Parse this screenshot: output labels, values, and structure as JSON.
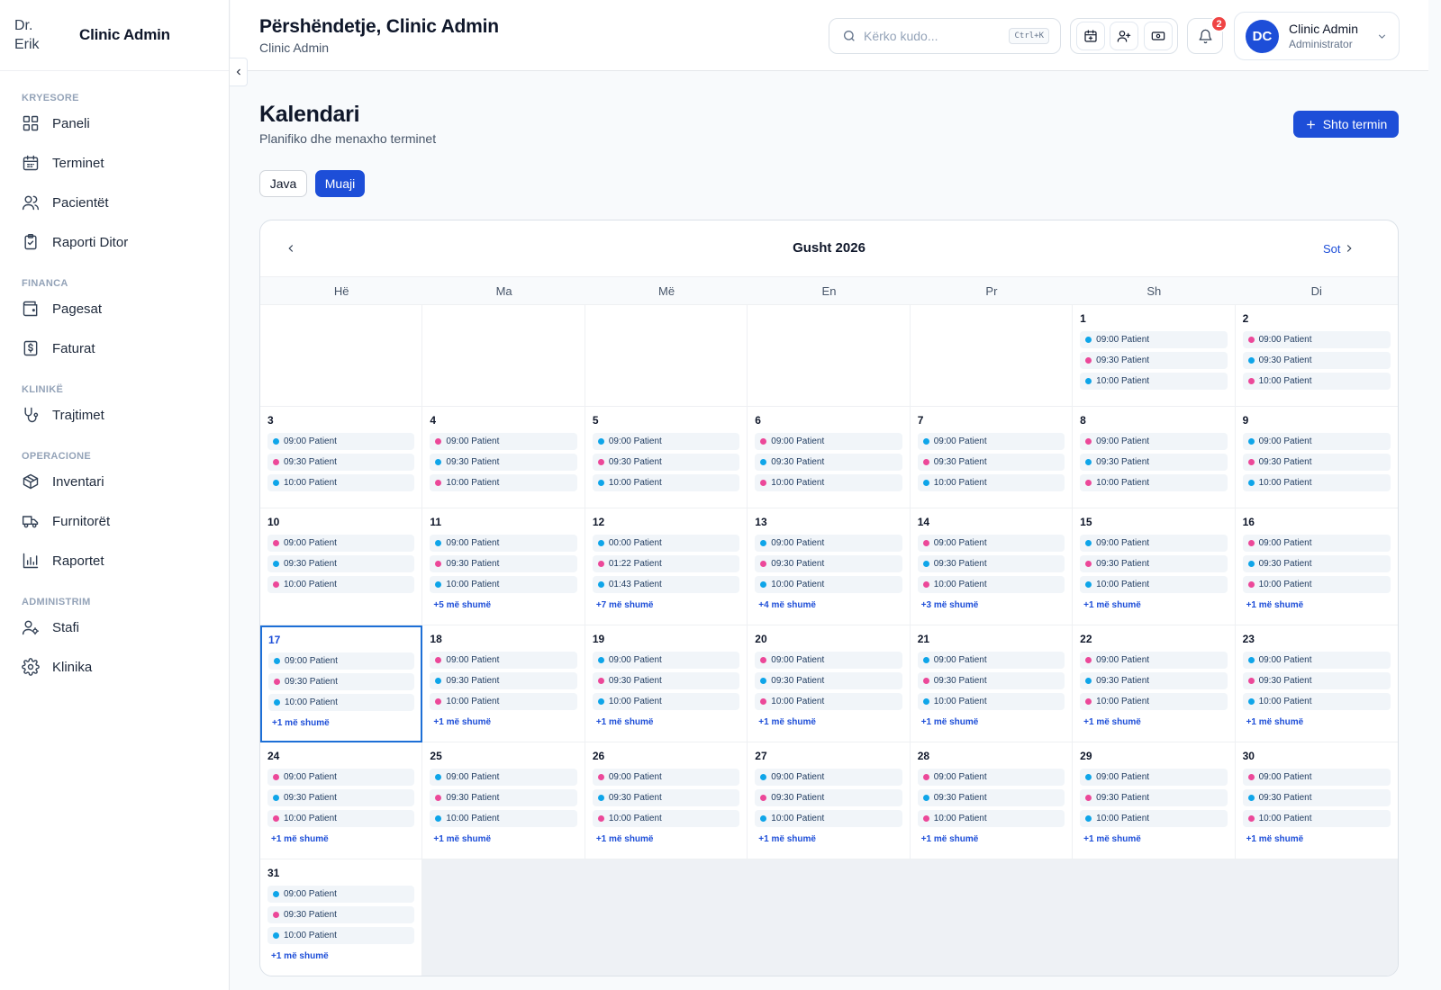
{
  "brand": {
    "logo_alt": "Dr. Erik",
    "name": "Clinic Admin"
  },
  "nav": [
    {
      "section": "KRYESORE",
      "items": [
        {
          "name": "paneli",
          "icon": "dashboard-icon",
          "label": "Paneli"
        },
        {
          "name": "terminet",
          "icon": "calendar-icon",
          "label": "Terminet"
        },
        {
          "name": "pacientet",
          "icon": "users-icon",
          "label": "Pacientët"
        },
        {
          "name": "raporti-ditor",
          "icon": "clipboard-icon",
          "label": "Raporti Ditor"
        }
      ]
    },
    {
      "section": "FINANCA",
      "items": [
        {
          "name": "pagesat",
          "icon": "wallet-icon",
          "label": "Pagesat"
        },
        {
          "name": "faturat",
          "icon": "invoice-icon",
          "label": "Faturat"
        }
      ]
    },
    {
      "section": "KLINIKË",
      "items": [
        {
          "name": "trajtimet",
          "icon": "stethoscope-icon",
          "label": "Trajtimet"
        }
      ]
    },
    {
      "section": "OPERACIONE",
      "items": [
        {
          "name": "inventari",
          "icon": "package-icon",
          "label": "Inventari"
        },
        {
          "name": "furnitoret",
          "icon": "truck-icon",
          "label": "Furnitorët"
        },
        {
          "name": "raportet",
          "icon": "bar-chart-icon",
          "label": "Raportet"
        }
      ]
    },
    {
      "section": "ADMINISTRIM",
      "items": [
        {
          "name": "stafi",
          "icon": "user-cog-icon",
          "label": "Stafi"
        },
        {
          "name": "klinika",
          "icon": "gear-icon",
          "label": "Klinika"
        }
      ]
    }
  ],
  "header": {
    "greeting": "Përshëndetje, Clinic Admin",
    "subtitle": "Clinic Admin",
    "search_placeholder": "Kërko kudo...",
    "search_shortcut": "Ctrl+K",
    "notifications_count": "2",
    "user": {
      "initials": "DC",
      "name": "Clinic Admin",
      "role": "Administrator"
    }
  },
  "page": {
    "title": "Kalendari",
    "subtitle": "Planifiko dhe menaxho terminet",
    "add_button": "Shto termin",
    "views": {
      "week": "Java",
      "month": "Muaji"
    }
  },
  "calendar": {
    "month_title": "Gusht 2026",
    "today_label": "Sot",
    "weekdays": [
      "Hë",
      "Ma",
      "Më",
      "En",
      "Pr",
      "Sh",
      "Di"
    ],
    "leading_blanks": 5,
    "today": 17,
    "colors": {
      "blue": "#0ea5e9",
      "pink": "#ec4899"
    },
    "days": [
      {
        "day": "1",
        "events": [
          [
            "09:00 Patient",
            "blue"
          ],
          [
            "09:30 Patient",
            "pink"
          ],
          [
            "10:00 Patient",
            "blue"
          ]
        ],
        "more": ""
      },
      {
        "day": "2",
        "events": [
          [
            "09:00 Patient",
            "pink"
          ],
          [
            "09:30 Patient",
            "blue"
          ],
          [
            "10:00 Patient",
            "pink"
          ]
        ],
        "more": ""
      },
      {
        "day": "3",
        "events": [
          [
            "09:00 Patient",
            "blue"
          ],
          [
            "09:30 Patient",
            "pink"
          ],
          [
            "10:00 Patient",
            "blue"
          ]
        ],
        "more": ""
      },
      {
        "day": "4",
        "events": [
          [
            "09:00 Patient",
            "pink"
          ],
          [
            "09:30 Patient",
            "blue"
          ],
          [
            "10:00 Patient",
            "pink"
          ]
        ],
        "more": ""
      },
      {
        "day": "5",
        "events": [
          [
            "09:00 Patient",
            "blue"
          ],
          [
            "09:30 Patient",
            "pink"
          ],
          [
            "10:00 Patient",
            "blue"
          ]
        ],
        "more": ""
      },
      {
        "day": "6",
        "events": [
          [
            "09:00 Patient",
            "pink"
          ],
          [
            "09:30 Patient",
            "blue"
          ],
          [
            "10:00 Patient",
            "pink"
          ]
        ],
        "more": ""
      },
      {
        "day": "7",
        "events": [
          [
            "09:00 Patient",
            "blue"
          ],
          [
            "09:30 Patient",
            "pink"
          ],
          [
            "10:00 Patient",
            "blue"
          ]
        ],
        "more": ""
      },
      {
        "day": "8",
        "events": [
          [
            "09:00 Patient",
            "pink"
          ],
          [
            "09:30 Patient",
            "blue"
          ],
          [
            "10:00 Patient",
            "pink"
          ]
        ],
        "more": ""
      },
      {
        "day": "9",
        "events": [
          [
            "09:00 Patient",
            "blue"
          ],
          [
            "09:30 Patient",
            "pink"
          ],
          [
            "10:00 Patient",
            "blue"
          ]
        ],
        "more": ""
      },
      {
        "day": "10",
        "events": [
          [
            "09:00 Patient",
            "pink"
          ],
          [
            "09:30 Patient",
            "blue"
          ],
          [
            "10:00 Patient",
            "pink"
          ]
        ],
        "more": ""
      },
      {
        "day": "11",
        "events": [
          [
            "09:00 Patient",
            "blue"
          ],
          [
            "09:30 Patient",
            "pink"
          ],
          [
            "10:00 Patient",
            "blue"
          ]
        ],
        "more": "+5 më shumë"
      },
      {
        "day": "12",
        "events": [
          [
            "00:00 Patient",
            "blue"
          ],
          [
            "01:22 Patient",
            "pink"
          ],
          [
            "01:43 Patient",
            "blue"
          ]
        ],
        "more": "+7 më shumë"
      },
      {
        "day": "13",
        "events": [
          [
            "09:00 Patient",
            "blue"
          ],
          [
            "09:30 Patient",
            "pink"
          ],
          [
            "10:00 Patient",
            "blue"
          ]
        ],
        "more": "+4 më shumë"
      },
      {
        "day": "14",
        "events": [
          [
            "09:00 Patient",
            "pink"
          ],
          [
            "09:30 Patient",
            "blue"
          ],
          [
            "10:00 Patient",
            "pink"
          ]
        ],
        "more": "+3 më shumë"
      },
      {
        "day": "15",
        "events": [
          [
            "09:00 Patient",
            "blue"
          ],
          [
            "09:30 Patient",
            "pink"
          ],
          [
            "10:00 Patient",
            "blue"
          ]
        ],
        "more": "+1 më shumë"
      },
      {
        "day": "16",
        "events": [
          [
            "09:00 Patient",
            "pink"
          ],
          [
            "09:30 Patient",
            "blue"
          ],
          [
            "10:00 Patient",
            "pink"
          ]
        ],
        "more": "+1 më shumë"
      },
      {
        "day": "17",
        "events": [
          [
            "09:00 Patient",
            "blue"
          ],
          [
            "09:30 Patient",
            "pink"
          ],
          [
            "10:00 Patient",
            "blue"
          ]
        ],
        "more": "+1 më shumë"
      },
      {
        "day": "18",
        "events": [
          [
            "09:00 Patient",
            "pink"
          ],
          [
            "09:30 Patient",
            "blue"
          ],
          [
            "10:00 Patient",
            "pink"
          ]
        ],
        "more": "+1 më shumë"
      },
      {
        "day": "19",
        "events": [
          [
            "09:00 Patient",
            "blue"
          ],
          [
            "09:30 Patient",
            "pink"
          ],
          [
            "10:00 Patient",
            "blue"
          ]
        ],
        "more": "+1 më shumë"
      },
      {
        "day": "20",
        "events": [
          [
            "09:00 Patient",
            "pink"
          ],
          [
            "09:30 Patient",
            "blue"
          ],
          [
            "10:00 Patient",
            "pink"
          ]
        ],
        "more": "+1 më shumë"
      },
      {
        "day": "21",
        "events": [
          [
            "09:00 Patient",
            "blue"
          ],
          [
            "09:30 Patient",
            "pink"
          ],
          [
            "10:00 Patient",
            "blue"
          ]
        ],
        "more": "+1 më shumë"
      },
      {
        "day": "22",
        "events": [
          [
            "09:00 Patient",
            "pink"
          ],
          [
            "09:30 Patient",
            "blue"
          ],
          [
            "10:00 Patient",
            "pink"
          ]
        ],
        "more": "+1 më shumë"
      },
      {
        "day": "23",
        "events": [
          [
            "09:00 Patient",
            "blue"
          ],
          [
            "09:30 Patient",
            "pink"
          ],
          [
            "10:00 Patient",
            "blue"
          ]
        ],
        "more": "+1 më shumë"
      },
      {
        "day": "24",
        "events": [
          [
            "09:00 Patient",
            "pink"
          ],
          [
            "09:30 Patient",
            "blue"
          ],
          [
            "10:00 Patient",
            "pink"
          ]
        ],
        "more": "+1 më shumë"
      },
      {
        "day": "25",
        "events": [
          [
            "09:00 Patient",
            "blue"
          ],
          [
            "09:30 Patient",
            "pink"
          ],
          [
            "10:00 Patient",
            "blue"
          ]
        ],
        "more": "+1 më shumë"
      },
      {
        "day": "26",
        "events": [
          [
            "09:00 Patient",
            "pink"
          ],
          [
            "09:30 Patient",
            "blue"
          ],
          [
            "10:00 Patient",
            "pink"
          ]
        ],
        "more": "+1 më shumë"
      },
      {
        "day": "27",
        "events": [
          [
            "09:00 Patient",
            "blue"
          ],
          [
            "09:30 Patient",
            "pink"
          ],
          [
            "10:00 Patient",
            "blue"
          ]
        ],
        "more": "+1 më shumë"
      },
      {
        "day": "28",
        "events": [
          [
            "09:00 Patient",
            "pink"
          ],
          [
            "09:30 Patient",
            "blue"
          ],
          [
            "10:00 Patient",
            "pink"
          ]
        ],
        "more": "+1 më shumë"
      },
      {
        "day": "29",
        "events": [
          [
            "09:00 Patient",
            "blue"
          ],
          [
            "09:30 Patient",
            "pink"
          ],
          [
            "10:00 Patient",
            "blue"
          ]
        ],
        "more": "+1 më shumë"
      },
      {
        "day": "30",
        "events": [
          [
            "09:00 Patient",
            "pink"
          ],
          [
            "09:30 Patient",
            "blue"
          ],
          [
            "10:00 Patient",
            "pink"
          ]
        ],
        "more": "+1 më shumë"
      },
      {
        "day": "31",
        "events": [
          [
            "09:00 Patient",
            "blue"
          ],
          [
            "09:30 Patient",
            "pink"
          ],
          [
            "10:00 Patient",
            "blue"
          ]
        ],
        "more": "+1 më shumë"
      }
    ]
  }
}
